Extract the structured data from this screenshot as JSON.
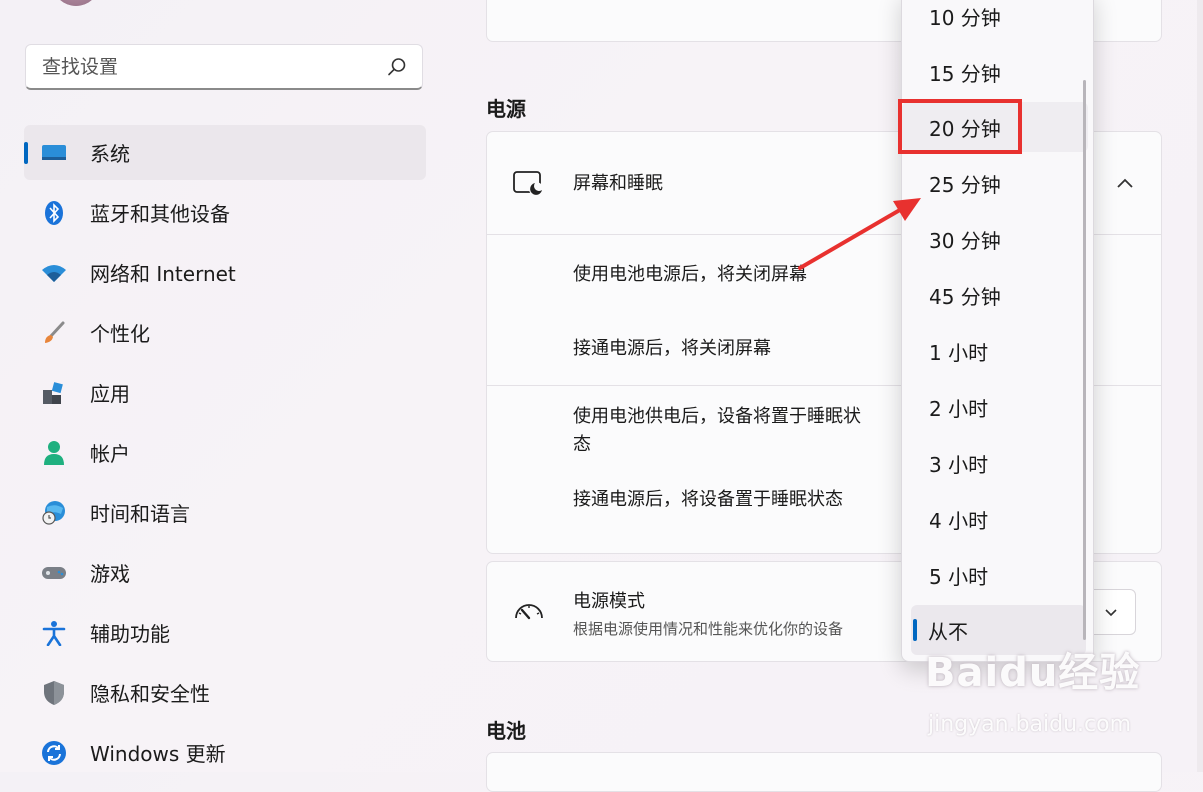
{
  "search": {
    "placeholder": "查找设置"
  },
  "sidebar": {
    "items": [
      {
        "label": "系统",
        "icon": "system-icon",
        "selected": true
      },
      {
        "label": "蓝牙和其他设备",
        "icon": "bluetooth-icon"
      },
      {
        "label": "网络和 Internet",
        "icon": "wifi-icon"
      },
      {
        "label": "个性化",
        "icon": "brush-icon"
      },
      {
        "label": "应用",
        "icon": "apps-icon"
      },
      {
        "label": "帐户",
        "icon": "account-icon"
      },
      {
        "label": "时间和语言",
        "icon": "globe-clock-icon"
      },
      {
        "label": "游戏",
        "icon": "gamepad-icon"
      },
      {
        "label": "辅助功能",
        "icon": "accessibility-icon"
      },
      {
        "label": "隐私和安全性",
        "icon": "shield-icon"
      },
      {
        "label": "Windows 更新",
        "icon": "update-icon"
      }
    ]
  },
  "main": {
    "power_title": "电源",
    "screen_sleep": {
      "title": "屏幕和睡眠",
      "battery_screen_off": "使用电池电源后，将关闭屏幕",
      "plugged_screen_off": "接通电源后，将关闭屏幕",
      "battery_sleep": "使用电池供电后，设备将置于睡眠状态",
      "plugged_sleep": "接通电源后，将设备置于睡眠状态"
    },
    "power_mode": {
      "title": "电源模式",
      "subtitle": "根据电源使用情况和性能来优化你的设备"
    },
    "battery_title": "电池"
  },
  "dropdown": {
    "options": [
      "10 分钟",
      "15 分钟",
      "20 分钟",
      "25 分钟",
      "30 分钟",
      "45 分钟",
      "1 小时",
      "2 小时",
      "3 小时",
      "4 小时",
      "5 小时",
      "从不"
    ],
    "highlighted": "20 分钟",
    "selected": "从不"
  },
  "watermark": {
    "brand": "Baidu经验",
    "url": "jingyan.baidu.com"
  },
  "colors": {
    "accent": "#0067c0",
    "annotation": "#e8312f"
  }
}
